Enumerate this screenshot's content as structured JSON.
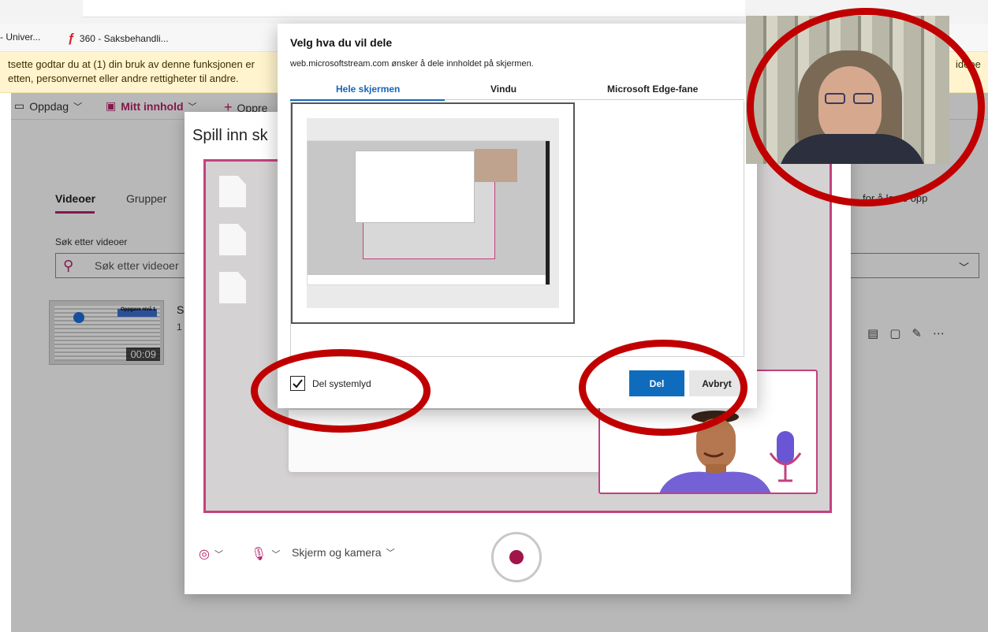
{
  "browser": {
    "tabs": [
      {
        "label": "- Univer..."
      },
      {
        "label": "360 - Saksbehandli..."
      }
    ]
  },
  "infobar": {
    "line1_left": "tsette godtar du at (1) din bruk av denne funksjonen er",
    "line2_left": "etten, personvernet eller andre rettigheter til andre.",
    "line1_right": "ideoe"
  },
  "nav": {
    "discover": "Oppdag",
    "my_content": "Mitt innhold",
    "create": "Oppre"
  },
  "content": {
    "tabs": [
      "Videoer",
      "Grupper"
    ],
    "search_label": "Søk etter videoer",
    "search_placeholder": "Søk etter videoer",
    "upload_hint": "for å laste opp",
    "video": {
      "title_initial": "S",
      "meta_initial": "1",
      "thumb_title": "Oppgave nivå 1",
      "duration": "00:09"
    }
  },
  "record_dialog": {
    "title": "Spill inn sk",
    "controls": {
      "source": "Skjerm og kamera"
    }
  },
  "share_dialog": {
    "title": "Velg hva du vil dele",
    "subtitle": "web.microsoftstream.com ønsker å dele innholdet på skjermen.",
    "tabs": [
      "Hele skjermen",
      "Vindu",
      "Microsoft Edge-fane"
    ],
    "active_tab": "Hele skjermen",
    "checkbox_label": "Del systemlyd",
    "checkbox_checked": true,
    "share_button": "Del",
    "cancel_button": "Avbryt"
  },
  "colors": {
    "accent": "#b4236a",
    "primary_button": "#0f6cbd",
    "annotation": "#c00000",
    "infobar": "#fff4ce"
  }
}
